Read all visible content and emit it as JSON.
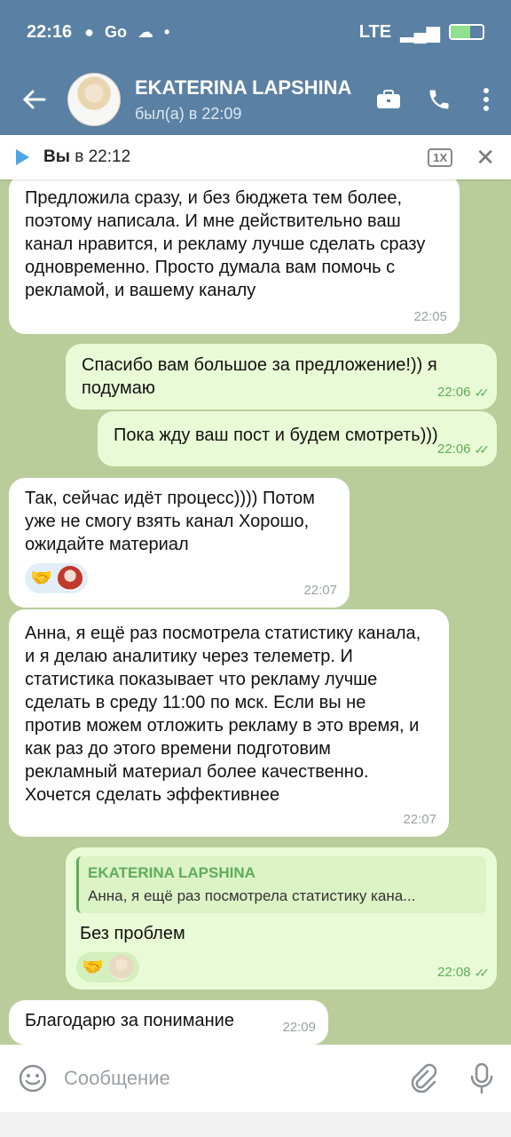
{
  "status_bar": {
    "time": "22:16",
    "network": "LTE"
  },
  "header": {
    "name": "EKATERINA LAPSHINA",
    "status": "был(а) в 22:09"
  },
  "player": {
    "sender": "Вы",
    "time": "в 22:12",
    "speed": "1X"
  },
  "messages": [
    {
      "dir": "in",
      "text": "Предложила сразу, и без бюджета тем более, поэтому написала. И мне действительно ваш канал нравится, и рекламу лучше сделать сразу одновременно. Просто думала вам помочь с рекламой, и вашему каналу",
      "time": "22:05"
    },
    {
      "dir": "out",
      "text": "Спасибо вам большое за предложение!)) я подумаю",
      "time": "22:06"
    },
    {
      "dir": "out",
      "text": "Пока жду ваш пост и будем смотреть)))",
      "time": "22:06"
    },
    {
      "dir": "in",
      "text": "Так, сейчас идёт процесс)))) Потом уже не смогу взять канал Хорошо, ожидайте материал",
      "time": "22:07",
      "reaction": "🤝"
    },
    {
      "dir": "in",
      "text": "Анна, я ещё раз посмотрела статистику канала, и я делаю аналитику через телеметр. И статистика показывает что рекламу лучше сделать в среду 11:00 по мск. Если вы не против можем отложить рекламу в это время, и как раз до этого времени подготовим рекламный материал более качественно. Хочется сделать эффективнее",
      "time": "22:07"
    },
    {
      "dir": "out",
      "reply_name": "EKATERINA LAPSHINA",
      "reply_text": "Анна, я ещё раз посмотрела статистику кана...",
      "text": "Без проблем",
      "time": "22:08",
      "reaction": "🤝"
    },
    {
      "dir": "in",
      "text": "Благодарю за понимание",
      "time": "22:09"
    }
  ],
  "input": {
    "placeholder": "Сообщение"
  }
}
